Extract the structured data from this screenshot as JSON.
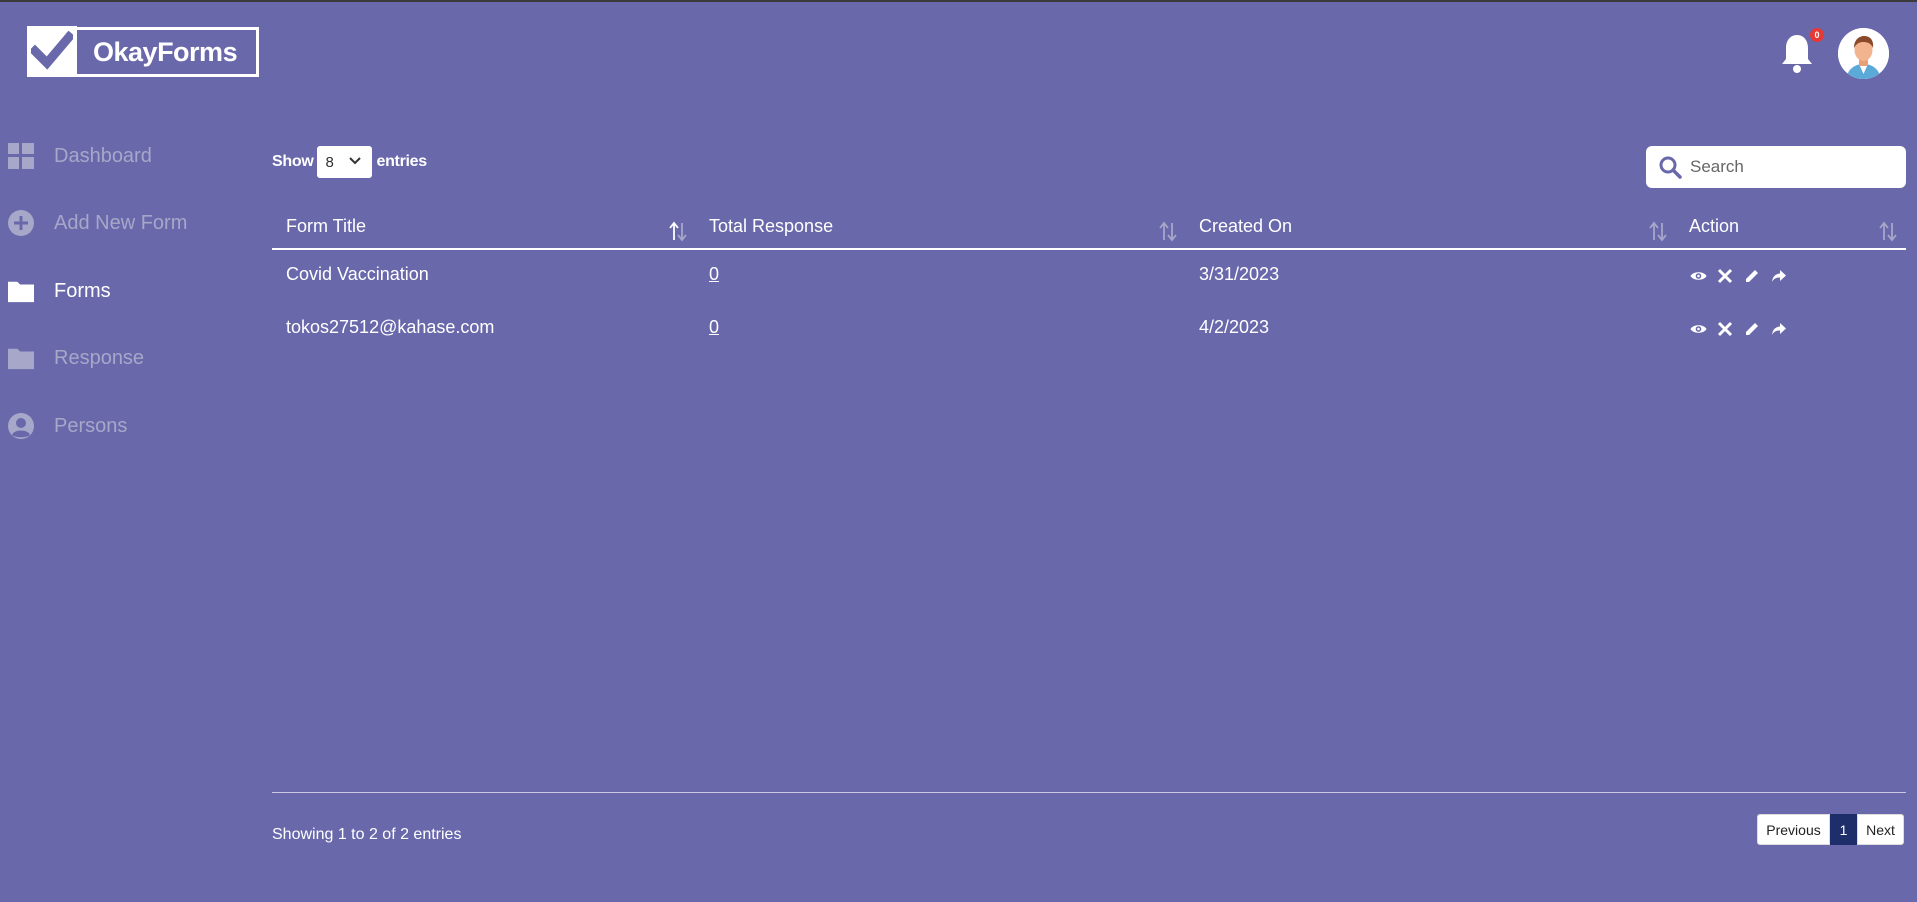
{
  "app": {
    "logo_text": "OkayForms",
    "logo_text_part1": "Okay",
    "logo_text_part2": "Forms"
  },
  "header": {
    "notification_count": "0"
  },
  "sidebar": {
    "items": [
      {
        "label": "Dashboard",
        "icon": "dashboard-icon",
        "active": false
      },
      {
        "label": "Add New Form",
        "icon": "plus-circle-icon",
        "active": false
      },
      {
        "label": "Forms",
        "icon": "folder-icon",
        "active": true
      },
      {
        "label": "Response",
        "icon": "folder-icon",
        "active": false
      },
      {
        "label": "Persons",
        "icon": "person-icon",
        "active": false
      }
    ]
  },
  "controls": {
    "show_label": "Show",
    "entries_value": "8",
    "entries_label": "entries",
    "search_placeholder": "Search"
  },
  "table": {
    "columns": [
      "Form Title",
      "Total Response",
      "Created On",
      "Action"
    ],
    "rows": [
      {
        "title": "Covid Vaccination",
        "responses": "0",
        "created": "3/31/2023"
      },
      {
        "title": "tokos27512@kahase.com",
        "responses": "0",
        "created": "4/2/2023"
      }
    ]
  },
  "footer": {
    "info": "Showing 1 to 2 of 2 entries",
    "prev": "Previous",
    "current_page": "1",
    "next": "Next"
  },
  "colors": {
    "background": "#6968ab",
    "active_page": "#1d2e6b",
    "badge": "#e53935"
  }
}
